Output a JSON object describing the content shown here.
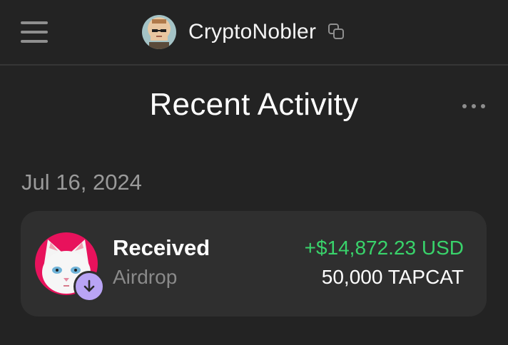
{
  "header": {
    "menu_icon": "hamburger-menu-icon",
    "avatar_icon": "pixel-art-avatar",
    "username": "CryptoNobler",
    "copy_icon": "copy-icon"
  },
  "main": {
    "title": "Recent Activity",
    "more_icon": "more-horizontal-icon"
  },
  "activity": {
    "groups": [
      {
        "date": "Jul 16, 2024",
        "items": [
          {
            "type": "Received",
            "subtitle": "Airdrop",
            "fiat_amount": "+$14,872.23 USD",
            "token_amount": "50,000 TAPCAT",
            "token_icon": "white-cat-token-icon",
            "badge_icon": "arrow-down-icon"
          }
        ]
      }
    ]
  },
  "colors": {
    "background": "#232323",
    "card": "#2f2f2f",
    "positive": "#39d36b",
    "muted": "#9a9a9a",
    "badge": "#b9a4f5",
    "token_bg": "#e8125c"
  }
}
